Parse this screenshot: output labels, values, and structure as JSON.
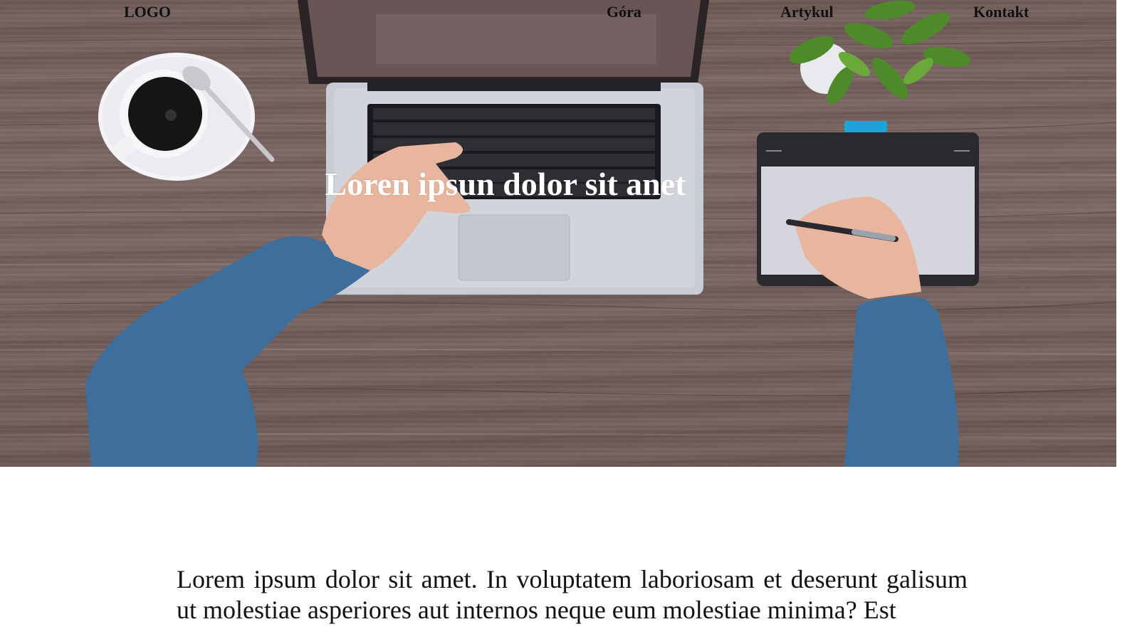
{
  "nav": {
    "logo": "LOGO",
    "links": [
      "Góra",
      "Artykul",
      "Kontakt"
    ]
  },
  "hero": {
    "title": "Loren ipsun dolor sit anet"
  },
  "article": {
    "text": "Lorem ipsum dolor sit amet. In voluptatem laboriosam et deserunt galisum ut molestiae asperiores aut internos neque eum molestiae minima? Est"
  }
}
